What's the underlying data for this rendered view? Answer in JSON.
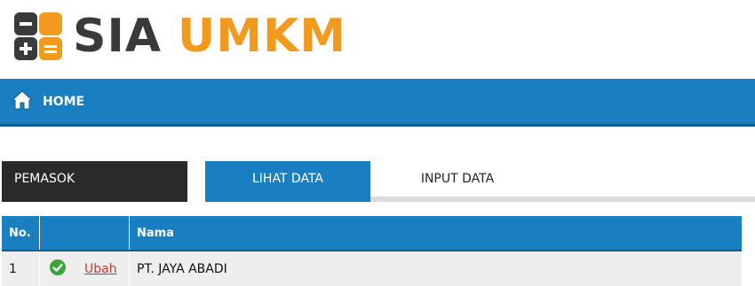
{
  "app": {
    "logo_text_primary": "SIA",
    "logo_text_secondary": "UMKM",
    "logo_icon": "calculator-icon",
    "colors": {
      "brand_orange": "#f29a1e",
      "brand_dark": "#3a3a3a",
      "primary_blue": "#1a7fc1"
    }
  },
  "nav": {
    "home_label": "HOME",
    "home_icon": "home-icon"
  },
  "section": {
    "label": "PEMASOK",
    "tabs": [
      {
        "label": "LIHAT DATA",
        "active": true
      },
      {
        "label": "INPUT DATA",
        "active": false
      }
    ]
  },
  "table": {
    "headers": [
      "No.",
      "",
      "Nama"
    ],
    "rows": [
      {
        "no": "1",
        "status_icon": "check-circle-icon",
        "edit_label": "Ubah",
        "nama": "PT. JAYA ABADI"
      }
    ]
  }
}
